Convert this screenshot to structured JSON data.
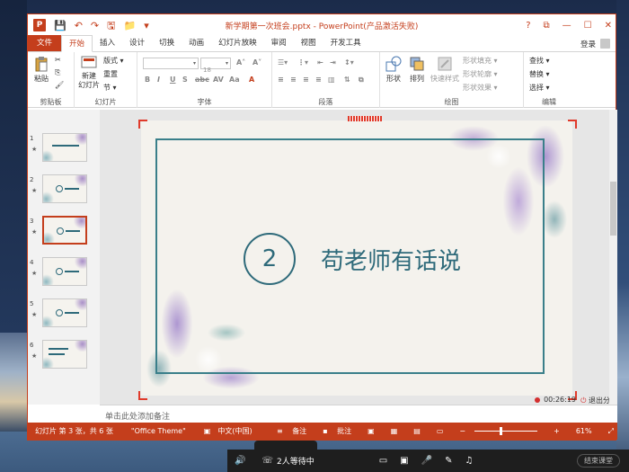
{
  "window": {
    "title": "新学期第一次班会.pptx - PowerPoint(产品激活失败)",
    "controls": [
      "?",
      "⧉",
      "—",
      "☐",
      "✕"
    ]
  },
  "qat": [
    "P",
    "💾",
    "↶",
    "↷",
    "🖫",
    "📁",
    "▾"
  ],
  "tabs": [
    "文件",
    "开始",
    "插入",
    "设计",
    "切换",
    "动画",
    "幻灯片放映",
    "审阅",
    "视图",
    "开发工具"
  ],
  "account": "登录",
  "ribbon": {
    "clipboard": {
      "label": "剪贴板",
      "paste": "粘贴"
    },
    "slides": {
      "label": "幻灯片",
      "new_slide": "新建\n幻灯片",
      "layout": "版式 ▾",
      "reset": "重置",
      "section": "节 ▾"
    },
    "font": {
      "label": "字体",
      "size": "18",
      "bold": "B",
      "italic": "I",
      "underline": "U",
      "shadow": "S",
      "strike": "abc",
      "spacing": "AV",
      "case": "Aa",
      "color": "A"
    },
    "paragraph": {
      "label": "段落"
    },
    "drawing": {
      "label": "绘图",
      "shapes": "形状",
      "arrange": "排列",
      "quick_styles": "快速样式",
      "fill": "形状填充 ▾",
      "outline": "形状轮廓 ▾",
      "effects": "形状效果 ▾"
    },
    "editing": {
      "label": "编辑",
      "find": "查找 ▾",
      "replace": "替换 ▾",
      "select": "选择 ▾"
    }
  },
  "slides_panel": {
    "items": [
      {
        "num": "1",
        "star": "★"
      },
      {
        "num": "2",
        "star": "★"
      },
      {
        "num": "3",
        "star": "★",
        "selected": true
      },
      {
        "num": "4",
        "star": "★"
      },
      {
        "num": "5",
        "star": "★"
      },
      {
        "num": "6",
        "star": "★"
      }
    ]
  },
  "slide": {
    "number": "2",
    "title": "苟老师有话说"
  },
  "recording": {
    "timer": "00:26:19",
    "exit_share": "退出分享"
  },
  "notes_placeholder": "单击此处添加备注",
  "status": {
    "slide_info": "幻灯片 第 3 张，共 6 张",
    "theme": "\"Office Theme\"",
    "language": "中文(中国)",
    "notes": "备注",
    "comments": "批注",
    "zoom": "61%"
  },
  "meeting": {
    "waiting": "2人等待中",
    "end_class": "结束课堂"
  },
  "colors": {
    "accent": "#c43e1c",
    "slide_teal": "#2e6a7a"
  }
}
